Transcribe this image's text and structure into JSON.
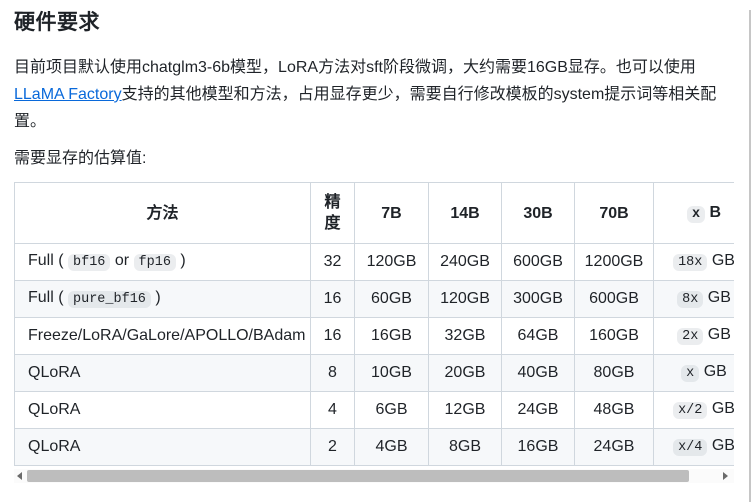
{
  "page": {
    "title": "硬件要求",
    "intro": {
      "text_before_link": "目前项目默认使用chatglm3-6b模型，LoRA方法对sft阶段微调，大约需要16GB显存。也可以使用",
      "link_text": "LLaMA Factory",
      "text_after_link": "支持的其他模型和方法，占用显存更少，需要自行修改模板的system提示词等相关配置。"
    },
    "estimate_label": "需要显存的估算值:"
  },
  "colors": {
    "text": "#1f2328",
    "link": "#0969da",
    "table_border": "#d0d7de",
    "row_stripe_bg": "#f6f8fa",
    "code_badge_bg": "#eceef1",
    "scrollbar_thumb": "#bdbdbd"
  },
  "table": {
    "header_cells": [
      [
        {
          "t": "text",
          "v": "方法"
        }
      ],
      [
        {
          "t": "text",
          "v": "精度"
        }
      ],
      [
        {
          "t": "text",
          "v": "7B"
        }
      ],
      [
        {
          "t": "text",
          "v": "14B"
        }
      ],
      [
        {
          "t": "text",
          "v": "30B"
        }
      ],
      [
        {
          "t": "text",
          "v": "70B"
        }
      ],
      [
        {
          "t": "code",
          "v": "x"
        },
        {
          "t": "text",
          "v": " B"
        }
      ]
    ],
    "rows": [
      [
        [
          {
            "t": "text",
            "v": "Full ( "
          },
          {
            "t": "code",
            "v": "bf16"
          },
          {
            "t": "text",
            "v": " or "
          },
          {
            "t": "code",
            "v": "fp16"
          },
          {
            "t": "text",
            "v": " )"
          }
        ],
        [
          {
            "t": "text",
            "v": "32"
          }
        ],
        [
          {
            "t": "text",
            "v": "120GB"
          }
        ],
        [
          {
            "t": "text",
            "v": "240GB"
          }
        ],
        [
          {
            "t": "text",
            "v": "600GB"
          }
        ],
        [
          {
            "t": "text",
            "v": "1200GB"
          }
        ],
        [
          {
            "t": "code",
            "v": "18x"
          },
          {
            "t": "text",
            "v": " GB"
          }
        ]
      ],
      [
        [
          {
            "t": "text",
            "v": "Full ( "
          },
          {
            "t": "code",
            "v": "pure_bf16"
          },
          {
            "t": "text",
            "v": " )"
          }
        ],
        [
          {
            "t": "text",
            "v": "16"
          }
        ],
        [
          {
            "t": "text",
            "v": "60GB"
          }
        ],
        [
          {
            "t": "text",
            "v": "120GB"
          }
        ],
        [
          {
            "t": "text",
            "v": "300GB"
          }
        ],
        [
          {
            "t": "text",
            "v": "600GB"
          }
        ],
        [
          {
            "t": "code",
            "v": "8x"
          },
          {
            "t": "text",
            "v": " GB"
          }
        ]
      ],
      [
        [
          {
            "t": "text",
            "v": "Freeze/LoRA/GaLore/APOLLO/BAdam"
          }
        ],
        [
          {
            "t": "text",
            "v": "16"
          }
        ],
        [
          {
            "t": "text",
            "v": "16GB"
          }
        ],
        [
          {
            "t": "text",
            "v": "32GB"
          }
        ],
        [
          {
            "t": "text",
            "v": "64GB"
          }
        ],
        [
          {
            "t": "text",
            "v": "160GB"
          }
        ],
        [
          {
            "t": "code",
            "v": "2x"
          },
          {
            "t": "text",
            "v": " GB"
          }
        ]
      ],
      [
        [
          {
            "t": "text",
            "v": "QLoRA"
          }
        ],
        [
          {
            "t": "text",
            "v": "8"
          }
        ],
        [
          {
            "t": "text",
            "v": "10GB"
          }
        ],
        [
          {
            "t": "text",
            "v": "20GB"
          }
        ],
        [
          {
            "t": "text",
            "v": "40GB"
          }
        ],
        [
          {
            "t": "text",
            "v": "80GB"
          }
        ],
        [
          {
            "t": "code",
            "v": "x"
          },
          {
            "t": "text",
            "v": " GB"
          }
        ]
      ],
      [
        [
          {
            "t": "text",
            "v": "QLoRA"
          }
        ],
        [
          {
            "t": "text",
            "v": "4"
          }
        ],
        [
          {
            "t": "text",
            "v": "6GB"
          }
        ],
        [
          {
            "t": "text",
            "v": "12GB"
          }
        ],
        [
          {
            "t": "text",
            "v": "24GB"
          }
        ],
        [
          {
            "t": "text",
            "v": "48GB"
          }
        ],
        [
          {
            "t": "code",
            "v": "x/2"
          },
          {
            "t": "text",
            "v": " GB"
          }
        ]
      ],
      [
        [
          {
            "t": "text",
            "v": "QLoRA"
          }
        ],
        [
          {
            "t": "text",
            "v": "2"
          }
        ],
        [
          {
            "t": "text",
            "v": "4GB"
          }
        ],
        [
          {
            "t": "text",
            "v": "8GB"
          }
        ],
        [
          {
            "t": "text",
            "v": "16GB"
          }
        ],
        [
          {
            "t": "text",
            "v": "24GB"
          }
        ],
        [
          {
            "t": "code",
            "v": "x/4"
          },
          {
            "t": "text",
            "v": " GB"
          }
        ]
      ]
    ]
  }
}
